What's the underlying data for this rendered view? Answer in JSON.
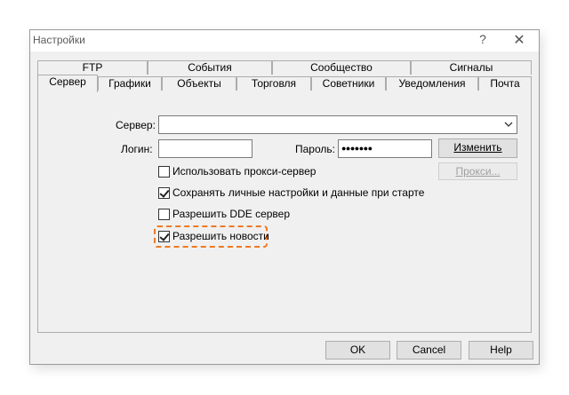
{
  "window": {
    "title": "Настройки",
    "help": "?",
    "close": "✕"
  },
  "tabs_row1": [
    "FTP",
    "События",
    "Сообщество",
    "Сигналы"
  ],
  "tabs_row2": [
    "Сервер",
    "Графики",
    "Объекты",
    "Торговля",
    "Советники",
    "Уведомления",
    "Почта"
  ],
  "selected_tab": "Сервер",
  "server": {
    "label": "Сервер:",
    "value": ""
  },
  "login": {
    "label": "Логин:",
    "value": ""
  },
  "password": {
    "label": "Пароль:",
    "value": "●●●●●●●"
  },
  "buttons": {
    "change": "Изменить",
    "proxy": "Прокси...",
    "ok": "OK",
    "cancel": "Cancel",
    "help": "Help"
  },
  "checkboxes": [
    {
      "label": "Использовать прокси-сервер",
      "checked": false
    },
    {
      "label": "Сохранять личные настройки и данные при старте",
      "checked": true
    },
    {
      "label": "Разрешить DDE сервер",
      "checked": false
    },
    {
      "label": "Разрешить новости",
      "checked": true
    }
  ],
  "colors": {
    "highlight": "#f07820",
    "dialog_bg": "#f0f0f0"
  }
}
